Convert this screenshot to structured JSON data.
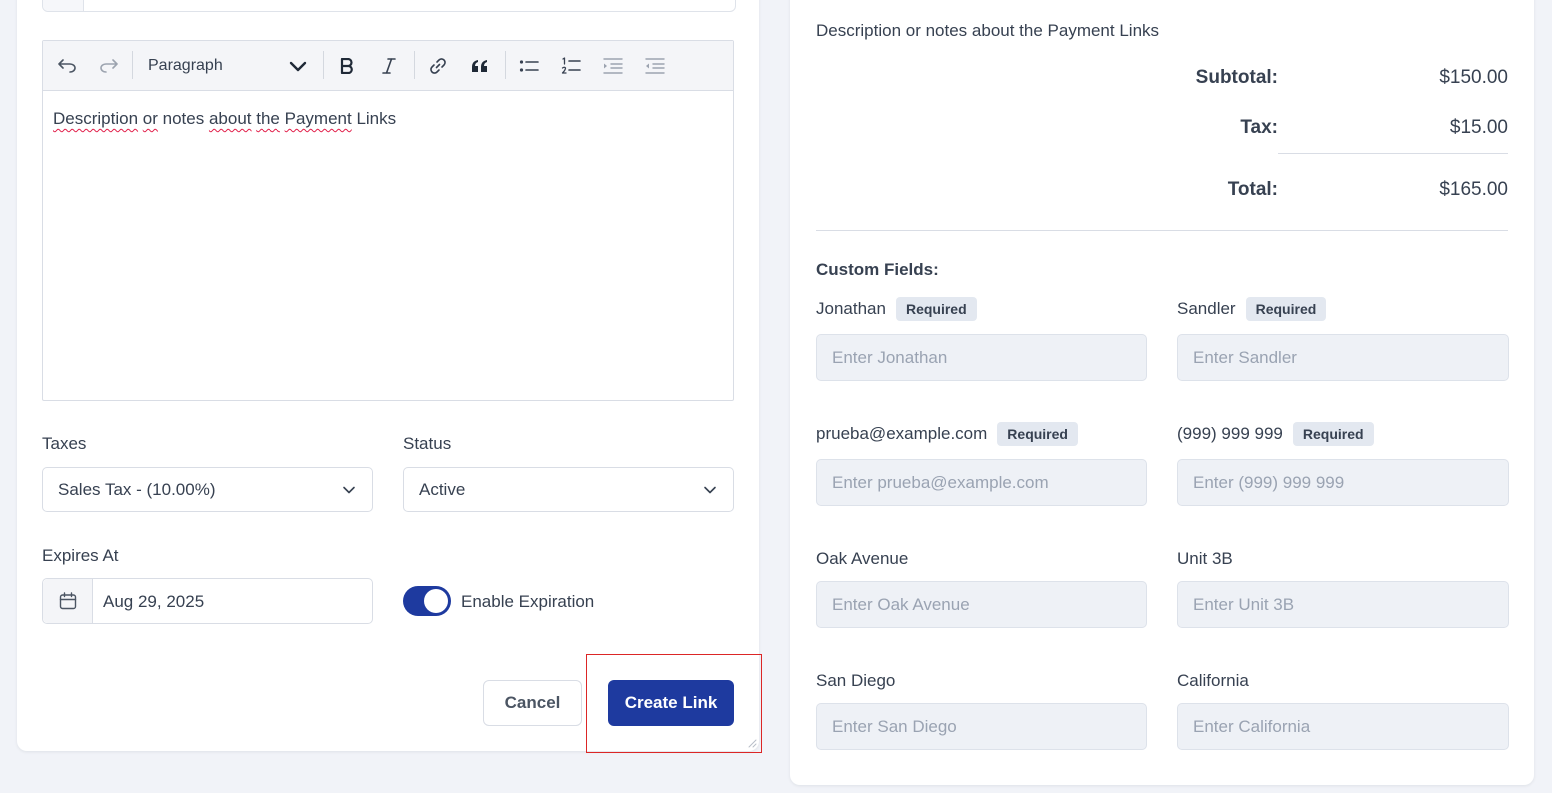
{
  "editor": {
    "paragraph_label": "Paragraph",
    "content_words": [
      "Description",
      "or",
      "notes",
      "about",
      "the",
      "Payment",
      "Links"
    ]
  },
  "form": {
    "taxes_label": "Taxes",
    "taxes_value": "Sales Tax - (10.00%)",
    "status_label": "Status",
    "status_value": "Active",
    "expires_label": "Expires At",
    "expires_value": "Aug 29, 2025",
    "enable_expiration_label": "Enable Expiration",
    "enable_expiration_on": true,
    "cancel_label": "Cancel",
    "create_label": "Create Link"
  },
  "preview": {
    "description": "Description or notes about the Payment Links",
    "subtotal_label": "Subtotal:",
    "subtotal_value": "$150.00",
    "tax_label": "Tax:",
    "tax_value": "$15.00",
    "total_label": "Total:",
    "total_value": "$165.00",
    "custom_fields_heading": "Custom Fields:",
    "required_badge": "Required",
    "fields": [
      {
        "label": "Jonathan",
        "required": true,
        "placeholder": "Enter Jonathan"
      },
      {
        "label": "Sandler",
        "required": true,
        "placeholder": "Enter Sandler"
      },
      {
        "label": "prueba@example.com",
        "required": true,
        "placeholder": "Enter prueba@example.com"
      },
      {
        "label": "(999) 999 999",
        "required": true,
        "placeholder": "Enter (999) 999 999"
      },
      {
        "label": "Oak Avenue",
        "required": false,
        "placeholder": "Enter Oak Avenue"
      },
      {
        "label": "Unit 3B",
        "required": false,
        "placeholder": "Enter Unit 3B"
      },
      {
        "label": "San Diego",
        "required": false,
        "placeholder": "Enter San Diego"
      },
      {
        "label": "California",
        "required": false,
        "placeholder": "Enter California"
      }
    ]
  },
  "colors": {
    "primary": "#1e3a9f",
    "highlight_border": "#dc2626",
    "spellcheck": "#e11d48"
  }
}
